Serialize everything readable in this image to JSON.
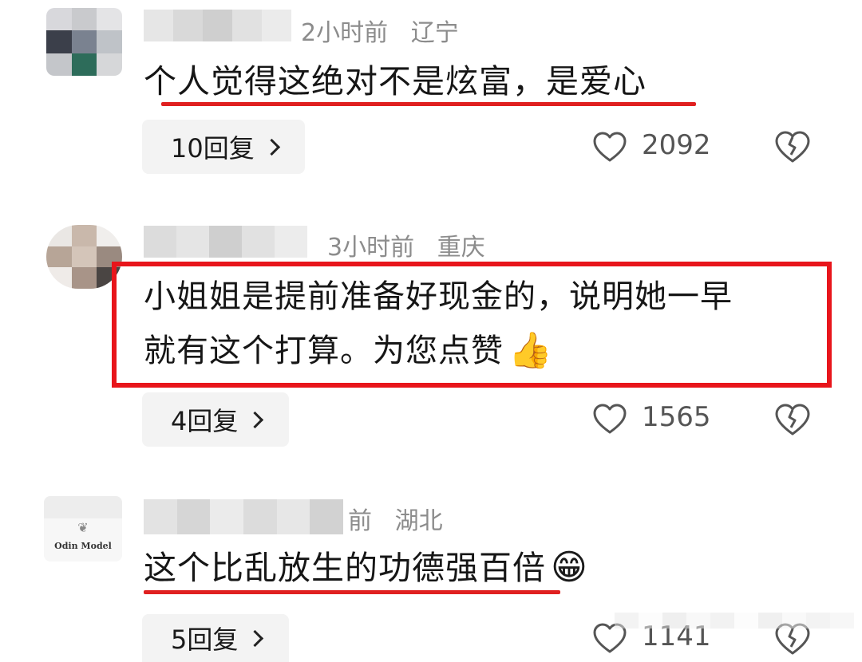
{
  "comments": [
    {
      "time": "2小时前",
      "location": "辽宁",
      "text": "个人觉得这绝对不是炫富，是爱心",
      "replies": "10回复",
      "likes": "2092"
    },
    {
      "time": "3小时前",
      "location": "重庆",
      "text_line1": "小姐姐是提前准备好现金的，说明她一早",
      "text_line2": "就有这个打算。为您点赞",
      "emoji": "👍",
      "replies": "4回复",
      "likes": "1565"
    },
    {
      "time_partial": "前",
      "location": "湖北",
      "avatar_text": "Odin Model",
      "text": "这个比乱放生的功德强百倍",
      "emoji": "😁",
      "replies": "5回复",
      "likes": "1141"
    }
  ],
  "colors": {
    "highlight_red": "#e8151b",
    "meta_gray": "#8c8c8c",
    "reply_bg": "#f3f3f3"
  },
  "icons": [
    "heart-outline-icon",
    "broken-heart-icon",
    "chevron-right-icon"
  ]
}
